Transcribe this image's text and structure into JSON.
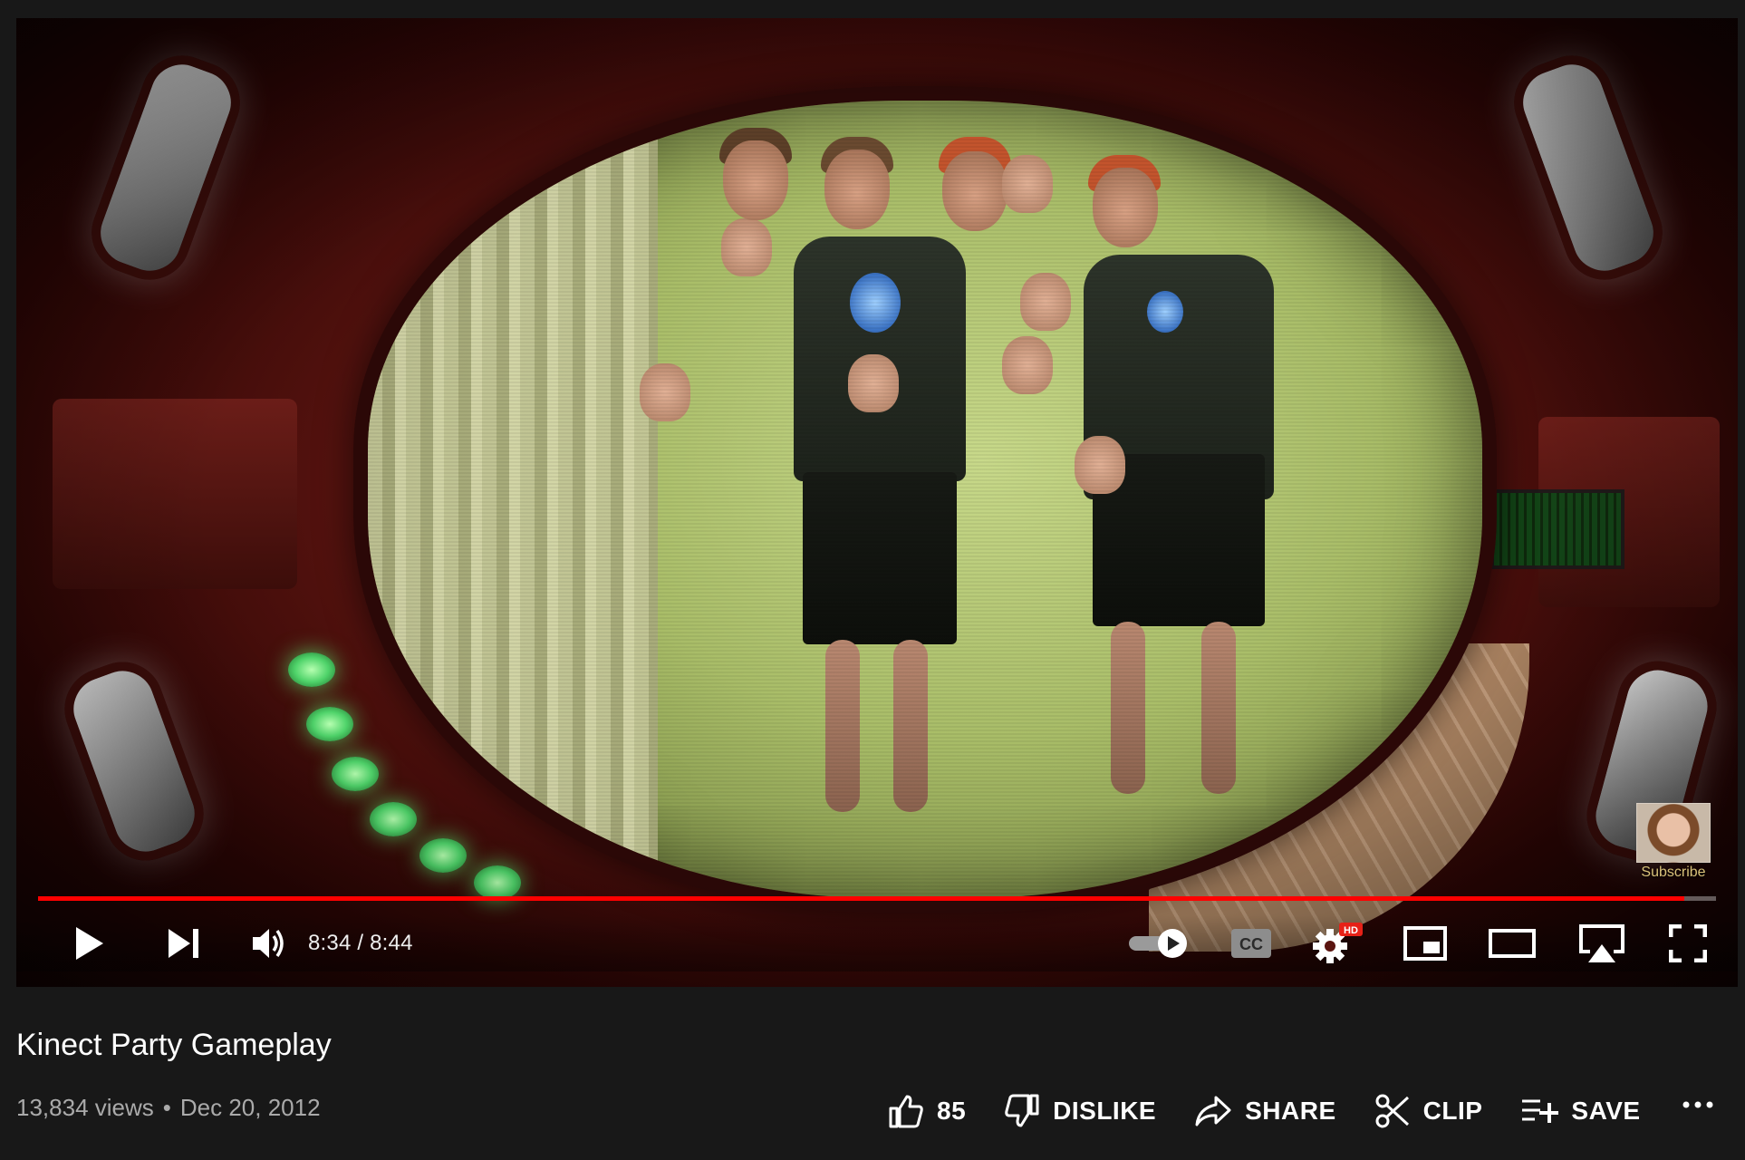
{
  "video": {
    "title": "Kinect Party Gameplay",
    "views": "13,834 views",
    "separator": "•",
    "date": "Dec 20, 2012"
  },
  "player": {
    "time_display": "8:34 / 8:44",
    "progress_fraction": 0.981,
    "hd_badge": "HD",
    "cc_label": "CC",
    "accent_color": "#ff0000",
    "endscreen": {
      "subscribe_label": "Subscribe"
    }
  },
  "actions": {
    "like_count": "85",
    "dislike_label": "DISLIKE",
    "share_label": "SHARE",
    "clip_label": "CLIP",
    "save_label": "SAVE"
  },
  "icons": {
    "play": "play-icon",
    "next": "next-icon",
    "volume": "volume-icon",
    "autoplay": "autoplay-toggle-icon",
    "captions": "captions-icon",
    "settings": "gear-icon",
    "miniplayer": "miniplayer-icon",
    "theater": "theater-icon",
    "cast": "airplay-icon",
    "fullscreen": "fullscreen-icon",
    "like": "thumbs-up-icon",
    "dislike": "thumbs-down-icon",
    "share": "share-arrow-icon",
    "clip": "scissors-icon",
    "save": "playlist-add-icon",
    "more": "more-dots-icon"
  }
}
